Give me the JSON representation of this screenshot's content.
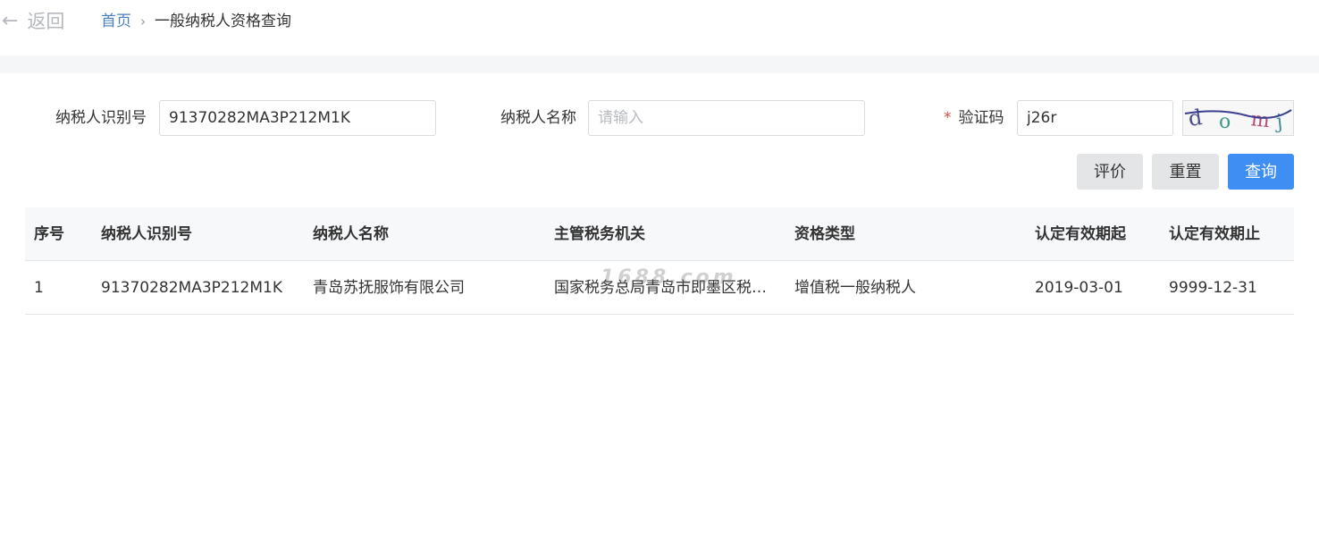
{
  "header": {
    "back_label": "返回",
    "breadcrumb_home": "首页",
    "breadcrumb_separator": "›",
    "breadcrumb_current": "一般纳税人资格查询"
  },
  "form": {
    "taxpayer_id_label": "纳税人识别号",
    "taxpayer_id_value": "91370282MA3P212M1K",
    "taxpayer_name_label": "纳税人名称",
    "taxpayer_name_placeholder": "请输入",
    "captcha_required_mark": "*",
    "captcha_label": "验证码",
    "captcha_value": "j26r",
    "captcha_image_text": "domj"
  },
  "buttons": {
    "evaluate": "评价",
    "reset": "重置",
    "query": "查询"
  },
  "table": {
    "headers": [
      "序号",
      "纳税人识别号",
      "纳税人名称",
      "主管税务机关",
      "资格类型",
      "认定有效期起",
      "认定有效期止"
    ],
    "rows": [
      [
        "1",
        "91370282MA3P212M1K",
        "青岛苏抚服饰有限公司",
        "国家税务总局青岛市即墨区税务局",
        "增值税一般纳税人",
        "2019-03-01",
        "9999-12-31"
      ]
    ]
  },
  "watermark": "1688.com",
  "colors": {
    "primary": "#3f8ef3",
    "link": "#4a7fc1",
    "required": "#e04a3f"
  }
}
